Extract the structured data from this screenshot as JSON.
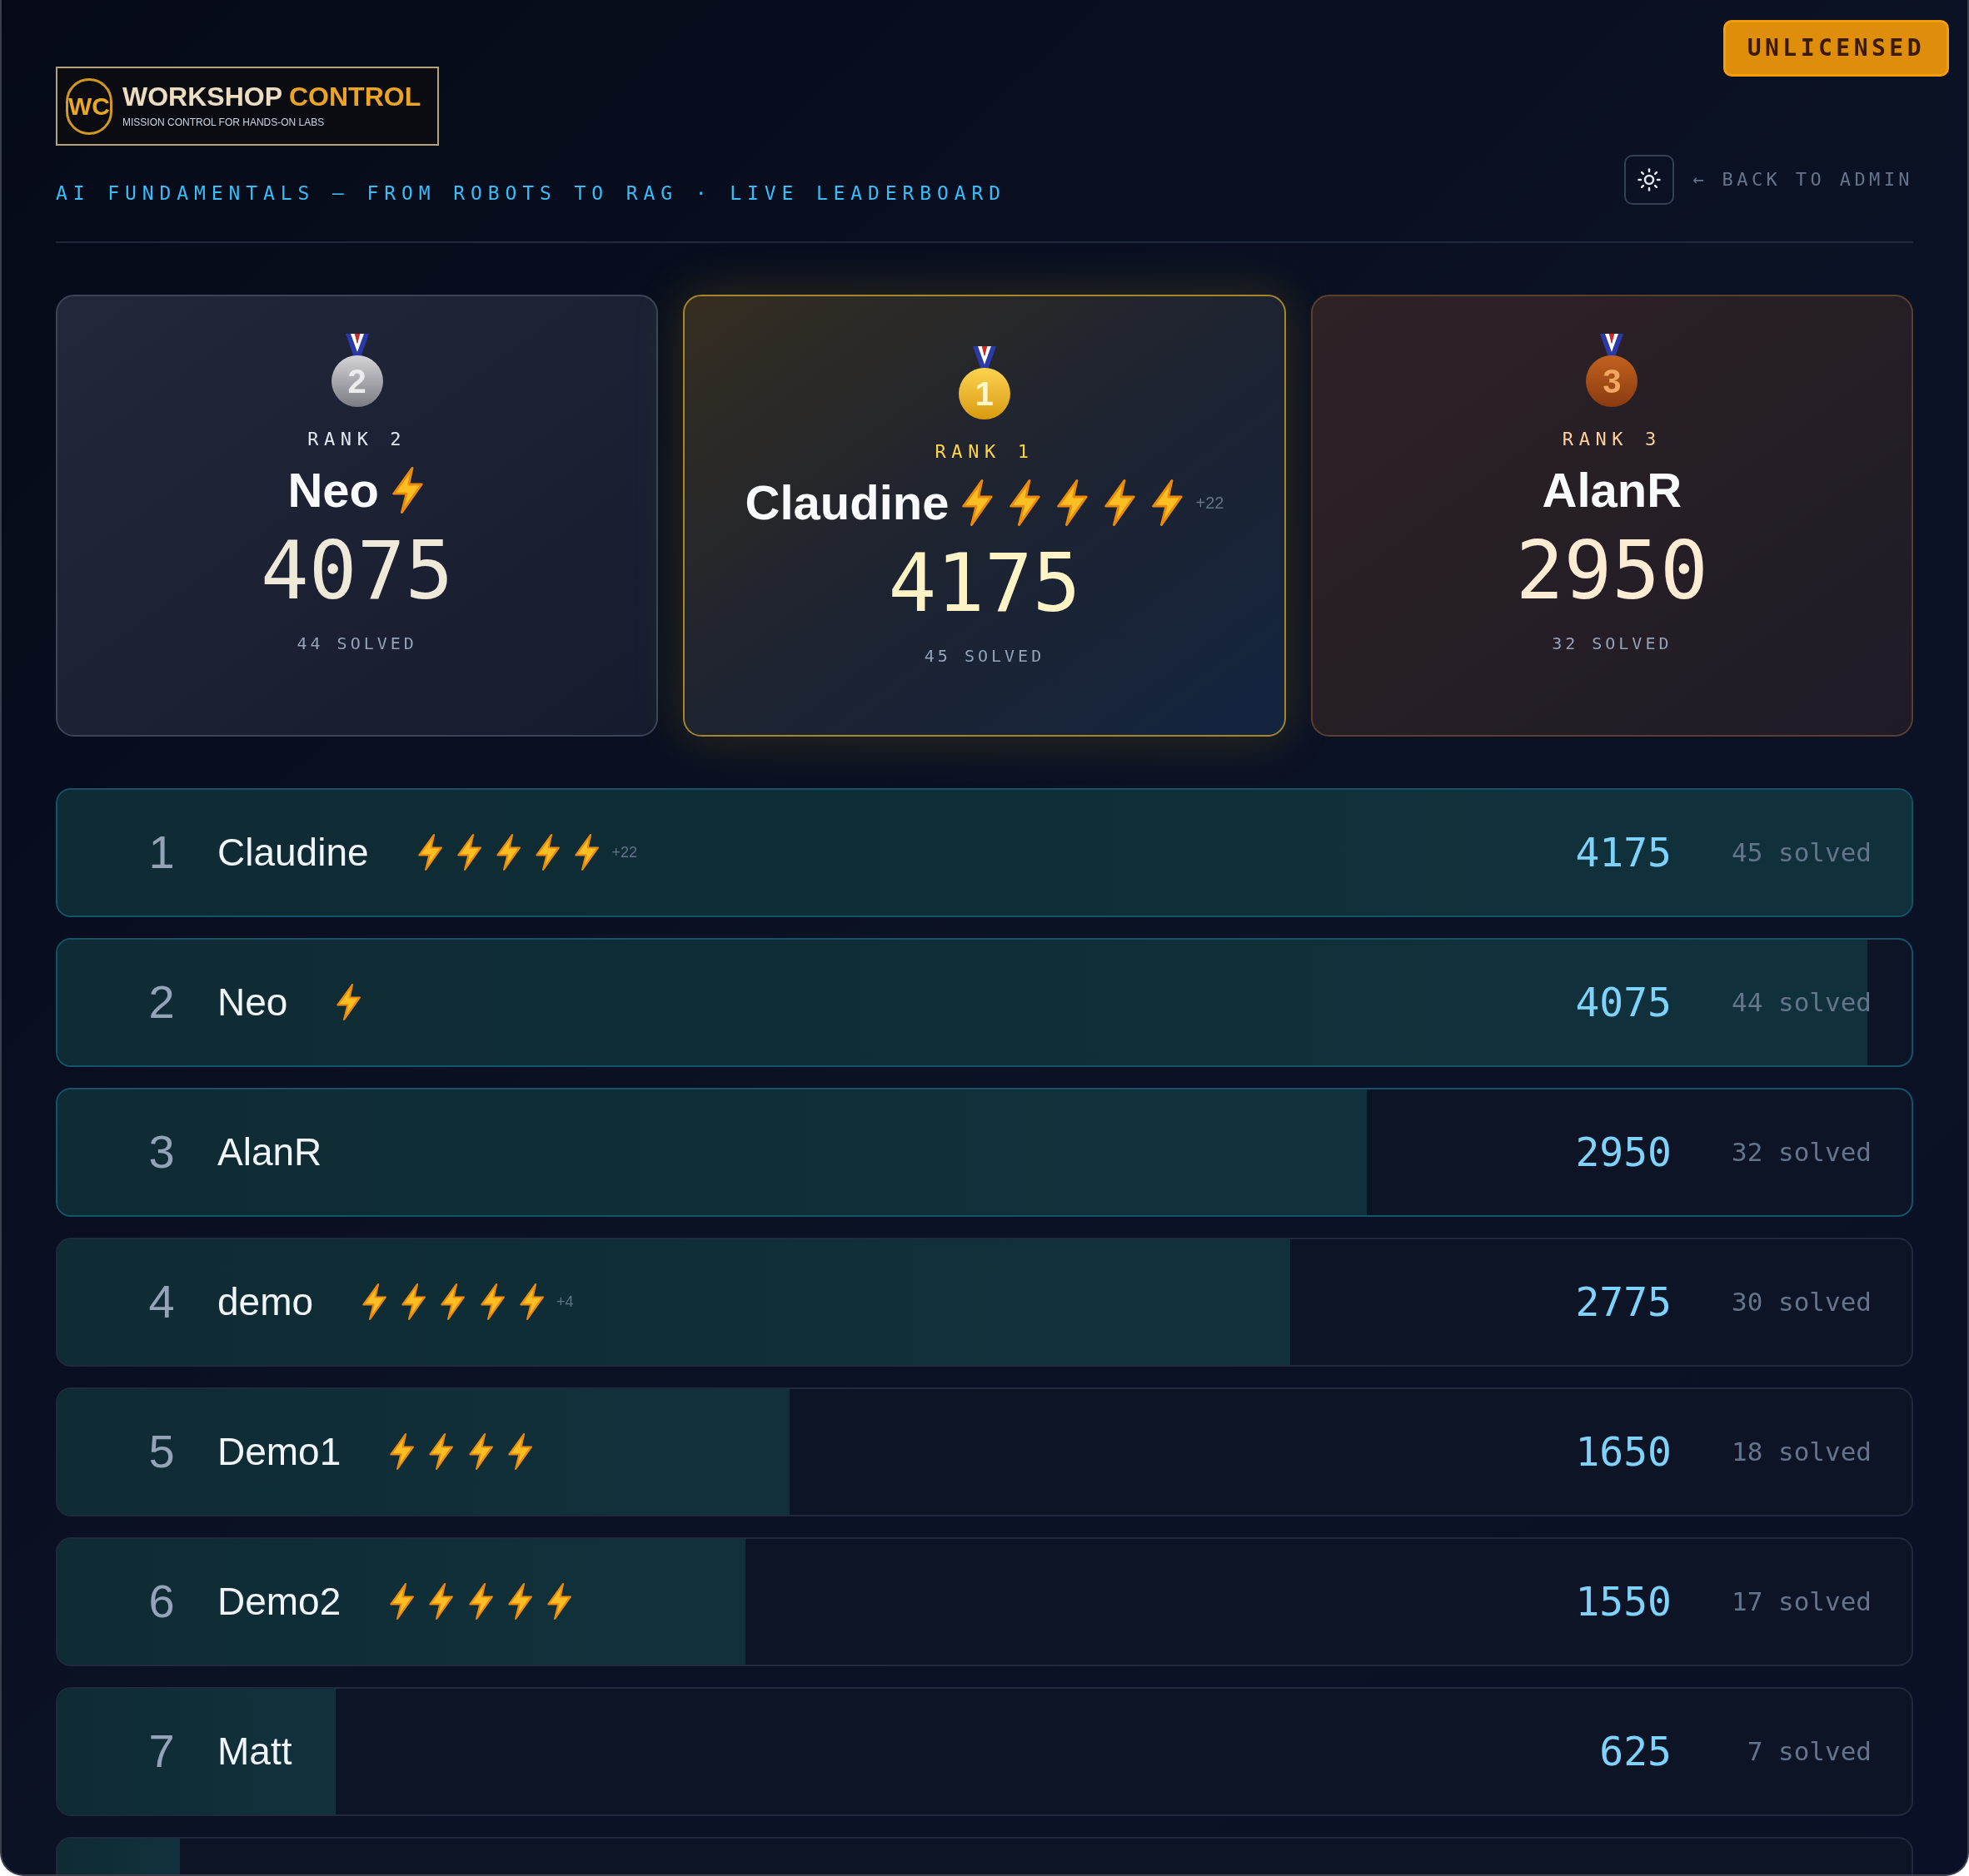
{
  "license_badge": "UNLICENSED",
  "logo": {
    "mark": "WC",
    "title_main": "WORKSHOP",
    "title_accent": "CONTROL",
    "tagline": "MISSION CONTROL FOR HANDS-ON LABS"
  },
  "subtitle": "AI FUNDAMENTALS — FROM ROBOTS TO RAG · LIVE LEADERBOARD",
  "back_link": "← BACK TO ADMIN",
  "podium": [
    {
      "kind": "silver",
      "medal": "2",
      "rank_label": "RANK 2",
      "name": "Neo",
      "badges": [
        {
          "kind": "bolt"
        }
      ],
      "score": "4075",
      "solved": "44 SOLVED"
    },
    {
      "kind": "gold",
      "medal": "1",
      "rank_label": "RANK 1",
      "name": "Claudine",
      "badges": [
        {
          "kind": "bolt"
        },
        {
          "kind": "bolt"
        },
        {
          "kind": "bolt"
        },
        {
          "kind": "bolt"
        },
        {
          "kind": "bolt"
        }
      ],
      "extra": "+22",
      "score": "4175",
      "solved": "45 SOLVED"
    },
    {
      "kind": "bronze",
      "medal": "3",
      "rank_label": "RANK 3",
      "name": "AlanR",
      "score": "2950",
      "solved": "32 SOLVED"
    }
  ],
  "rows": [
    {
      "rank": "1",
      "name": "Claudine",
      "badges": [
        {
          "kind": "bolt"
        },
        {
          "kind": "bolt"
        },
        {
          "kind": "bolt"
        },
        {
          "kind": "bolt"
        },
        {
          "kind": "bolt"
        }
      ],
      "extra": "+22",
      "score": "4175",
      "solved": "45 solved",
      "level": 1,
      "highlighted": true
    },
    {
      "rank": "2",
      "name": "Neo",
      "badges": [
        {
          "kind": "bolt"
        }
      ],
      "score": "4075",
      "solved": "44 solved",
      "level": 0.976,
      "highlighted": true
    },
    {
      "rank": "3",
      "name": "AlanR",
      "score": "2950",
      "solved": "32 solved",
      "level": 0.706,
      "highlighted": true
    },
    {
      "rank": "4",
      "name": "demo",
      "badges": [
        {
          "kind": "bolt"
        },
        {
          "kind": "bolt"
        },
        {
          "kind": "bolt"
        },
        {
          "kind": "bolt"
        },
        {
          "kind": "bolt"
        }
      ],
      "extra": "+4",
      "score": "2775",
      "solved": "30 solved",
      "level": 0.665,
      "highlighted": false
    },
    {
      "rank": "5",
      "name": "Demo1",
      "badges": [
        {
          "kind": "bolt"
        },
        {
          "kind": "bolt"
        },
        {
          "kind": "bolt"
        },
        {
          "kind": "bolt"
        }
      ],
      "score": "1650",
      "solved": "18 solved",
      "level": 0.395,
      "highlighted": false
    },
    {
      "rank": "6",
      "name": "Demo2",
      "badges": [
        {
          "kind": "bolt"
        },
        {
          "kind": "bolt"
        },
        {
          "kind": "bolt"
        },
        {
          "kind": "bolt"
        },
        {
          "kind": "bolt"
        }
      ],
      "score": "1550",
      "solved": "17 solved",
      "level": 0.371,
      "highlighted": false
    },
    {
      "rank": "7",
      "name": "Matt",
      "score": "625",
      "solved": "7 solved",
      "level": 0.15,
      "highlighted": false
    },
    {
      "level": 0.066,
      "highlighted": false
    }
  ]
}
